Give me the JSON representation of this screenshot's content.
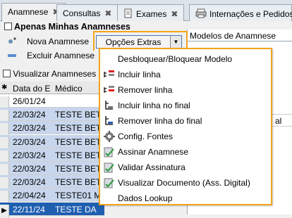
{
  "tabs": [
    {
      "label": "Anamnese",
      "closable": true
    },
    {
      "label": "Consultas",
      "closable": true
    },
    {
      "label": "Exames",
      "closable": true
    },
    {
      "label": "Internações e Pedidos",
      "closable": false
    }
  ],
  "filter": {
    "label": "Apenas Minhas Anamneses"
  },
  "toolbar": {
    "new_label": "Nova Anamnese",
    "delete_label": "Excluir Anamnese",
    "extra_label": "Opções Extras",
    "view_label": "Visualizar Anamneses In"
  },
  "right_panel": {
    "title": "Modelos de Anamnese",
    "partial_text": "al"
  },
  "grid": {
    "headers": [
      "Data do E",
      "Médico"
    ],
    "rows": [
      {
        "date": "26/01/24",
        "doctor": ""
      },
      {
        "date": "22/03/24",
        "doctor": "TESTE BET"
      },
      {
        "date": "22/03/24",
        "doctor": "TESTE BET"
      },
      {
        "date": "22/03/24",
        "doctor": "TESTE BET"
      },
      {
        "date": "22/03/24",
        "doctor": "TESTE BET"
      },
      {
        "date": "22/03/24",
        "doctor": "TESTE BET"
      },
      {
        "date": "22/03/24",
        "doctor": "TESTE BET"
      },
      {
        "date": "22/04/24",
        "doctor": "TESTE01 M"
      },
      {
        "date": "22/11/24",
        "doctor": "TESTE DA"
      }
    ]
  },
  "menu": {
    "items": [
      {
        "label": "Desbloquear/Bloquear Modelo",
        "icon": "none"
      },
      {
        "label": "Incluir linha",
        "icon": "insert-row-icon"
      },
      {
        "label": "Remover linha",
        "icon": "remove-row-icon"
      },
      {
        "label": "Incluir linha no final",
        "icon": "insert-row-end-icon"
      },
      {
        "label": "Remover linha do final",
        "icon": "remove-row-end-icon"
      },
      {
        "label": "Config. Fontes",
        "icon": "font-config-icon"
      },
      {
        "label": "Assinar Anamnese",
        "icon": "sign-icon"
      },
      {
        "label": "Validar Assinatura",
        "icon": "validate-signature-icon"
      },
      {
        "label": "Visualizar Documento (Ass. Digital)",
        "icon": "view-document-icon"
      },
      {
        "label": "Dados Lookup",
        "icon": "none"
      }
    ]
  },
  "colors": {
    "accent": "#f2a51c",
    "selection": "#1f5fb0",
    "row_highlight": "#c7d6ec"
  }
}
